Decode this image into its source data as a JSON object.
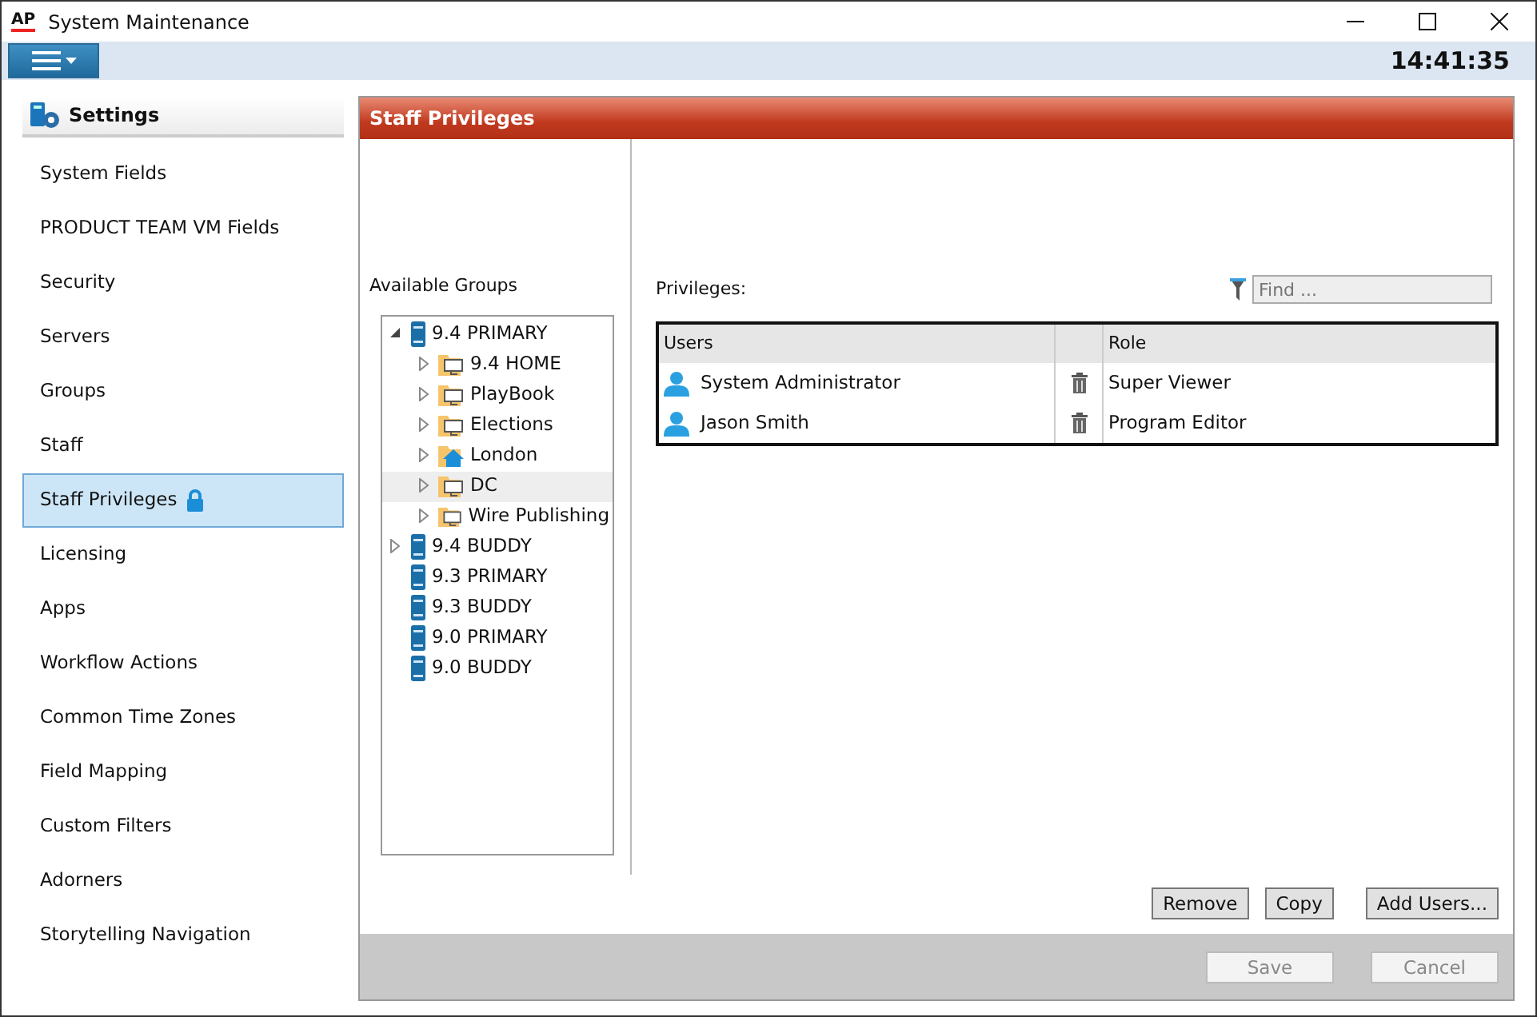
{
  "window": {
    "logo": "AP",
    "title": "System Maintenance"
  },
  "toolbar": {
    "clock": "14:41:35"
  },
  "sidebar": {
    "title": "Settings",
    "items": [
      {
        "label": "System Fields",
        "selected": false,
        "locked": false
      },
      {
        "label": "PRODUCT TEAM VM Fields",
        "selected": false,
        "locked": false
      },
      {
        "label": "Security",
        "selected": false,
        "locked": false
      },
      {
        "label": "Servers",
        "selected": false,
        "locked": false
      },
      {
        "label": "Groups",
        "selected": false,
        "locked": false
      },
      {
        "label": "Staff",
        "selected": false,
        "locked": false
      },
      {
        "label": "Staff Privileges",
        "selected": true,
        "locked": true
      },
      {
        "label": "Licensing",
        "selected": false,
        "locked": false
      },
      {
        "label": "Apps",
        "selected": false,
        "locked": false
      },
      {
        "label": "Workflow Actions",
        "selected": false,
        "locked": false
      },
      {
        "label": "Common Time Zones",
        "selected": false,
        "locked": false
      },
      {
        "label": "Field Mapping",
        "selected": false,
        "locked": false
      },
      {
        "label": "Custom Filters",
        "selected": false,
        "locked": false
      },
      {
        "label": "Adorners",
        "selected": false,
        "locked": false
      },
      {
        "label": "Storytelling Navigation",
        "selected": false,
        "locked": false
      }
    ]
  },
  "panel": {
    "title": "Staff Privileges",
    "groups": {
      "label": "Available Groups",
      "tree": [
        {
          "label": "9.4 PRIMARY",
          "kind": "server",
          "expanded": true,
          "selected": false,
          "children": [
            {
              "label": "9.4 HOME",
              "kind": "folder",
              "expanded": false,
              "selected": false
            },
            {
              "label": "PlayBook",
              "kind": "folder",
              "expanded": false,
              "selected": false
            },
            {
              "label": "Elections",
              "kind": "folder",
              "expanded": false,
              "selected": false
            },
            {
              "label": "London",
              "kind": "home",
              "expanded": false,
              "selected": false
            },
            {
              "label": "DC",
              "kind": "folder",
              "expanded": false,
              "selected": true
            },
            {
              "label": "Wire Publishing",
              "kind": "folder",
              "expanded": false,
              "selected": false
            }
          ]
        },
        {
          "label": "9.4 BUDDY",
          "kind": "server",
          "expanded": false,
          "selected": false
        },
        {
          "label": "9.3 PRIMARY",
          "kind": "server",
          "selected": false
        },
        {
          "label": "9.3 BUDDY",
          "kind": "server",
          "selected": false
        },
        {
          "label": "9.0 PRIMARY",
          "kind": "server",
          "selected": false
        },
        {
          "label": "9.0 BUDDY",
          "kind": "server",
          "selected": false
        }
      ]
    },
    "privileges": {
      "label": "Privileges:",
      "search": {
        "placeholder": "Find ..."
      },
      "table": {
        "columns": [
          "Users",
          "Role"
        ],
        "rows": [
          {
            "user": "System Administrator",
            "role": "Super Viewer"
          },
          {
            "user": "Jason Smith",
            "role": "Program Editor"
          }
        ]
      }
    },
    "actions": [
      {
        "label": "Remove",
        "disabled": false
      },
      {
        "label": "Copy",
        "disabled": false
      },
      {
        "label": "Add Users...",
        "disabled": false
      }
    ],
    "footer": [
      {
        "label": "Save",
        "disabled": true
      },
      {
        "label": "Cancel",
        "disabled": true
      }
    ]
  }
}
